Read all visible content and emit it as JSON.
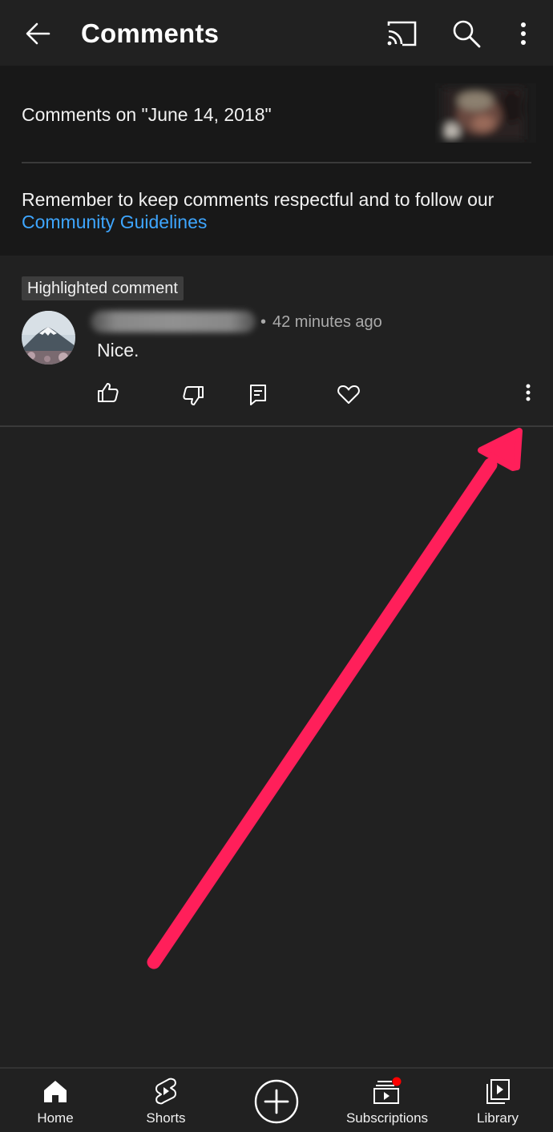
{
  "topbar": {
    "title": "Comments",
    "icons": [
      "back-arrow-icon",
      "cast-icon",
      "search-icon",
      "more-vert-icon"
    ]
  },
  "header": {
    "comments_on": "Comments on \"June 14, 2018\"",
    "reminder_text": "Remember to keep comments respectful and to follow our",
    "guidelines_link": "Community Guidelines"
  },
  "comment": {
    "badge": "Highlighted comment",
    "separator": "•",
    "time": "42 minutes ago",
    "text": "Nice.",
    "actions": [
      "thumb-up-icon",
      "thumb-down-icon",
      "reply-icon",
      "heart-icon",
      "more-vert-icon"
    ]
  },
  "bottom_nav": {
    "home": "Home",
    "shorts": "Shorts",
    "subscriptions": "Subscriptions",
    "library": "Library"
  },
  "colors": {
    "background": "#212121",
    "header_panel": "#181818",
    "link": "#3ea6ff",
    "annotation_arrow": "#ff1f5a",
    "notification_dot": "#ff0000"
  }
}
